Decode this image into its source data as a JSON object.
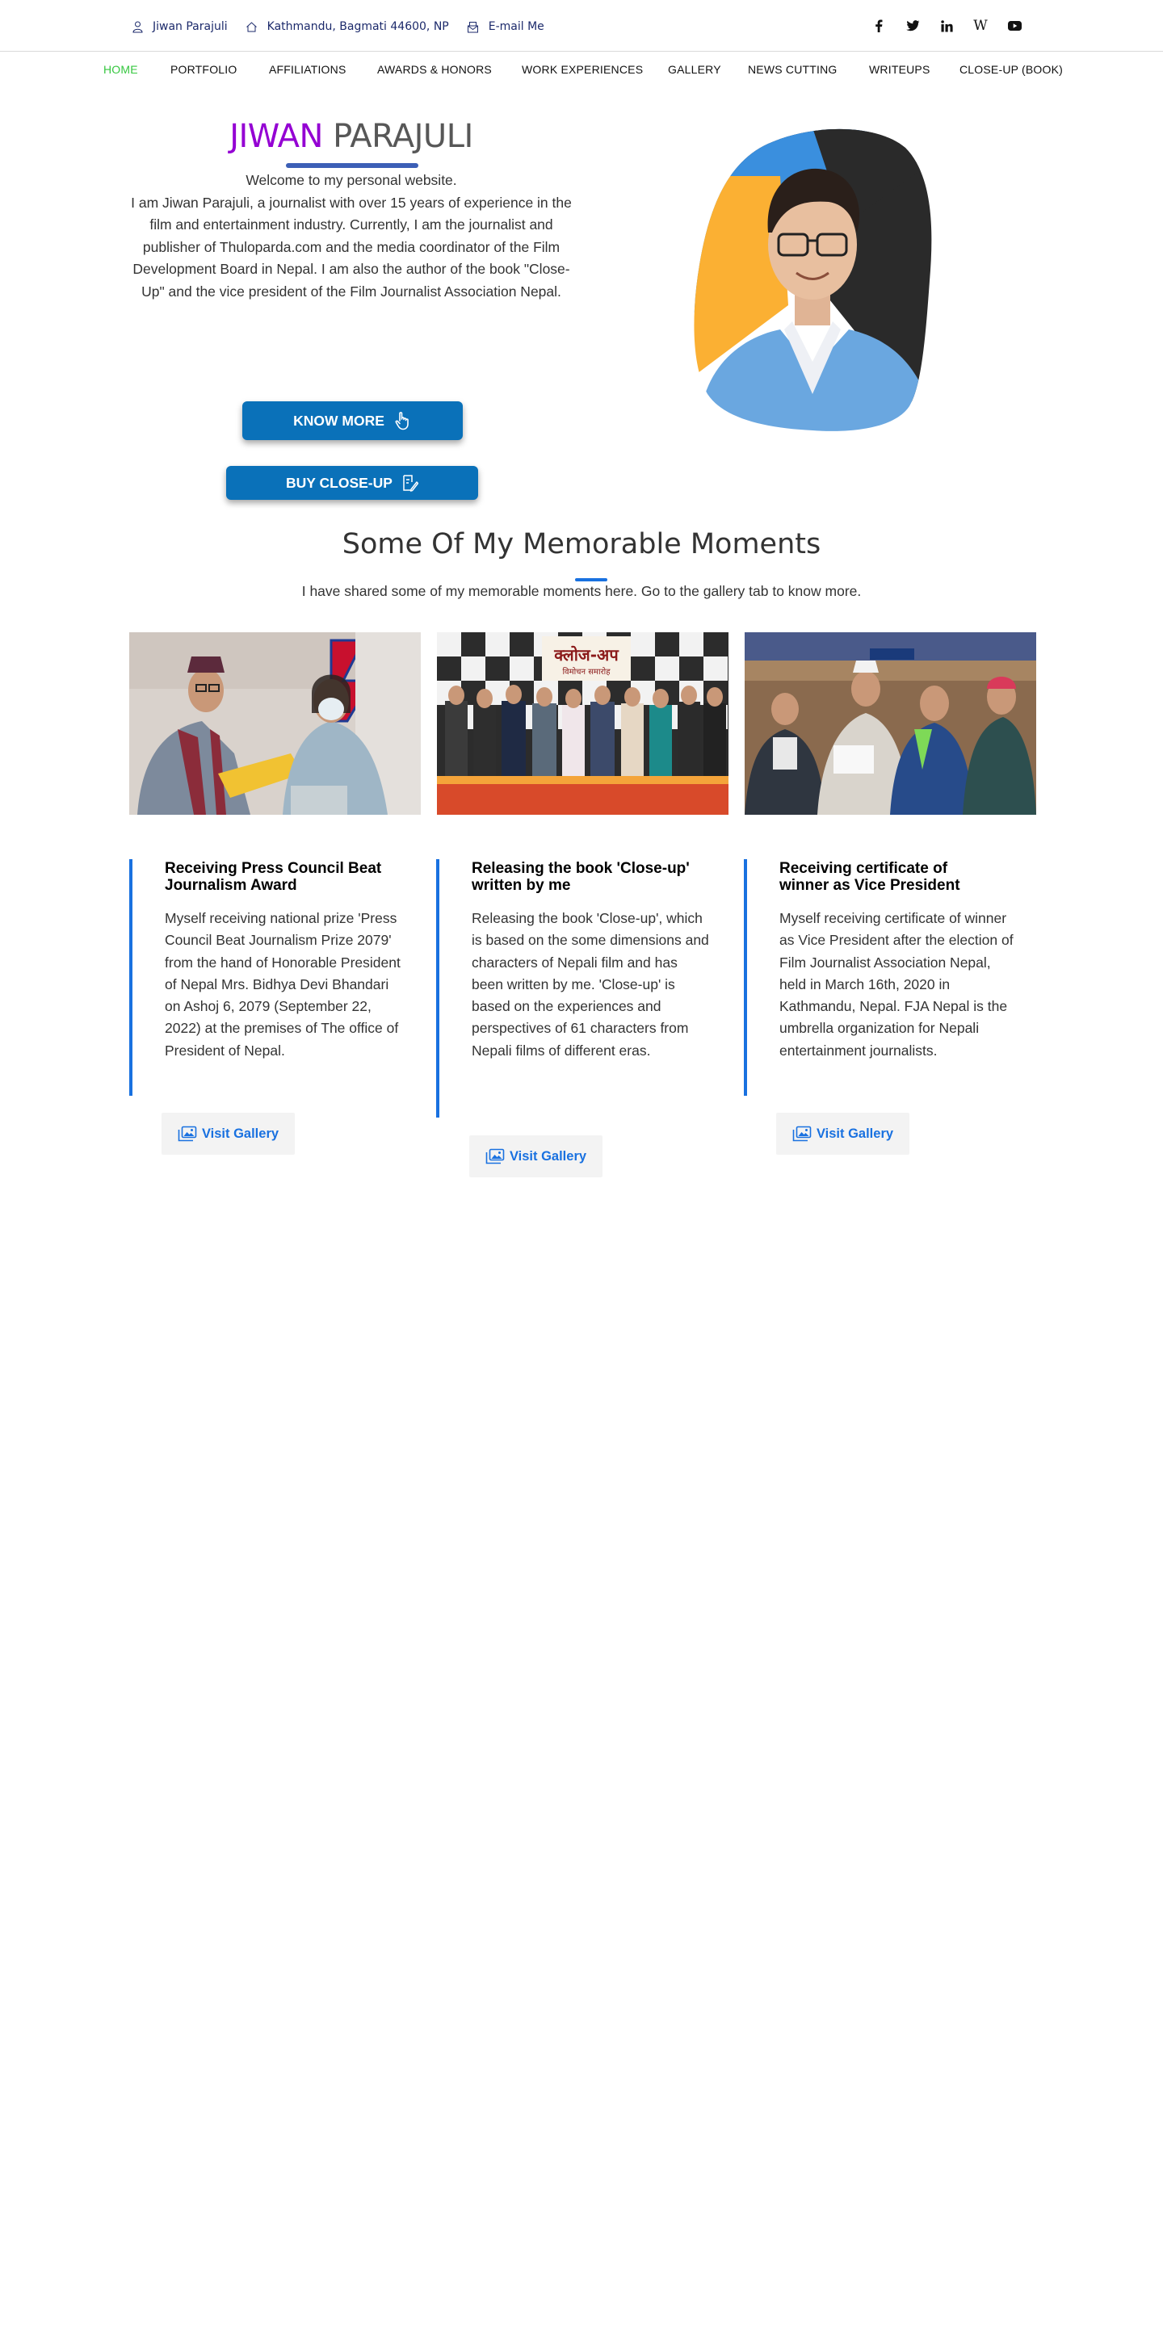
{
  "topbar": {
    "name": "Jiwan Parajuli",
    "address": "Kathmandu, Bagmati 44600, NP",
    "email_label": "E-mail Me"
  },
  "socials": [
    {
      "name": "facebook-icon",
      "glyph": "f"
    },
    {
      "name": "twitter-icon",
      "glyph": "twitter"
    },
    {
      "name": "linkedin-icon",
      "glyph": "in"
    },
    {
      "name": "wikipedia-icon",
      "glyph": "W"
    },
    {
      "name": "youtube-icon",
      "glyph": "youtube"
    }
  ],
  "nav": [
    "Home",
    "Portfolio",
    "Affiliations",
    "Awards & Honors",
    "Work Experiences",
    "Gallery",
    "News Cutting",
    "Writeups",
    "Close-Up (Book)"
  ],
  "hero": {
    "first_name": "JIWAN",
    "last_name": "PARAJULI",
    "text": "Welcome to my personal website.\nI am Jiwan Parajuli, a journalist with over 15 years of experience in the film and entertainment industry. Currently, I am the journalist and publisher of Thuloparda.com and the media coordinator of the Film Development Board in Nepal. I am also the author of the book \"Close-Up\" and the vice president of the Film Journalist Association Nepal.",
    "know_more": "KNOW MORE",
    "buy": "BUY CLOSE-UP"
  },
  "moments": {
    "title": "Some Of My Memorable Moments",
    "subtitle": "I have shared some of my memorable moments here. Go to the gallery tab to know more.",
    "photo2_banner": "क्लोज-अप",
    "photo2_sub": "विमोचन समारोह",
    "cards": [
      {
        "title": "Receiving Press Council Beat Journalism Award",
        "text": "Myself receiving national prize 'Press Council Beat Journalism Prize 2079' from the hand of Honorable President of Nepal Mrs. Bidhya Devi Bhandari on Ashoj 6, 2079 (September 22, 2022) at the premises of The office of President of Nepal.",
        "button": "Visit Gallery"
      },
      {
        "title": "Releasing the book 'Close-up' written by me",
        "text": "Releasing the book 'Close-up', which is based on the some dimensions and characters of Nepali film and has been written by me. 'Close-up' is based on the experiences and perspectives of 61 characters from Nepali films of different eras.",
        "button": "Visit Gallery"
      },
      {
        "title": "Receiving certificate of winner as Vice President",
        "text": "Myself receiving certificate of winner as Vice President after the election of Film Journalist Association Nepal, held in March 16th, 2020 in Kathmandu, Nepal. FJA Nepal is the umbrella organization for Nepali entertainment journalists.",
        "button": "Visit Gallery"
      }
    ]
  },
  "colors": {
    "accent": "#1971e0",
    "button": "#0a71b9",
    "nav_active": "#35c73f",
    "name_first": "#9400d3",
    "name_last": "#575757"
  }
}
